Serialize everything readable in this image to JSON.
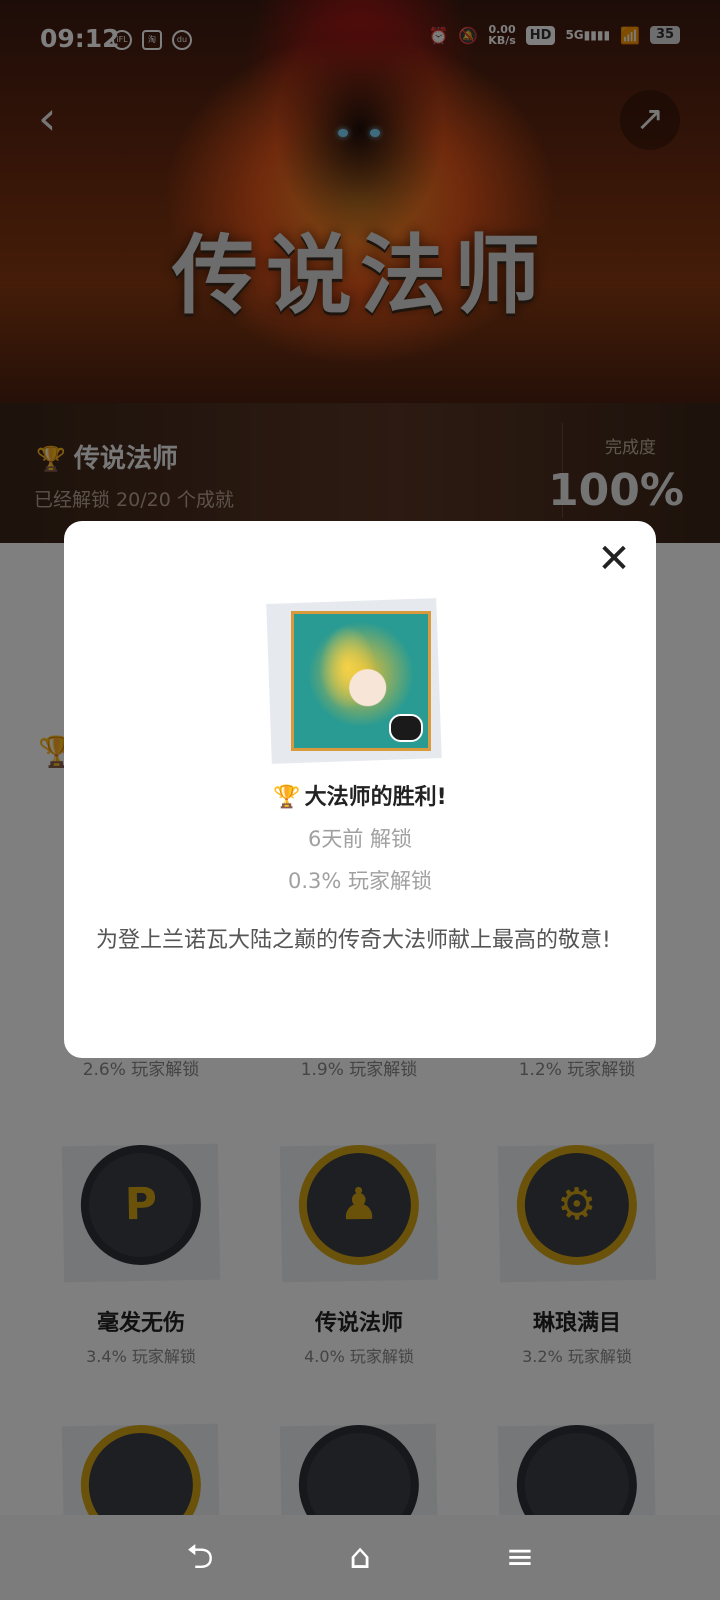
{
  "status_bar": {
    "time": "09:12",
    "icons": [
      "iflytek-icon",
      "taobao-icon",
      "du-icon"
    ],
    "net_speed_value": "0.00",
    "net_speed_unit": "KB/s",
    "hd_label": "HD",
    "signal_label": "5G",
    "battery": "35"
  },
  "hero": {
    "title": "传说法师"
  },
  "game_info": {
    "name": "传说法师",
    "unlocked_summary": "已经解锁 20/20 个成就",
    "completion_label": "完成度",
    "completion_value": "100%"
  },
  "row_stats": [
    "2.6% 玩家解锁",
    "1.9% 玩家解锁",
    "1.2% 玩家解锁"
  ],
  "achievements": [
    {
      "name": "毫发无伤",
      "stat": "3.4% 玩家解锁",
      "glyph": "P"
    },
    {
      "name": "传说法师",
      "stat": "4.0% 玩家解锁",
      "glyph": "♟"
    },
    {
      "name": "琳琅满目",
      "stat": "3.2% 玩家解锁",
      "glyph": "⚙"
    }
  ],
  "modal": {
    "title": "大法师的胜利!",
    "unlock_time": "6天前 解锁",
    "unlock_percent": "0.3% 玩家解锁",
    "description": "为登上兰诺瓦大陆之巅的传奇大法师献上最高的敬意!"
  },
  "colors": {
    "accent_gold": "#d4a514",
    "overlay": "rgba(0,0,0,0.5)"
  }
}
